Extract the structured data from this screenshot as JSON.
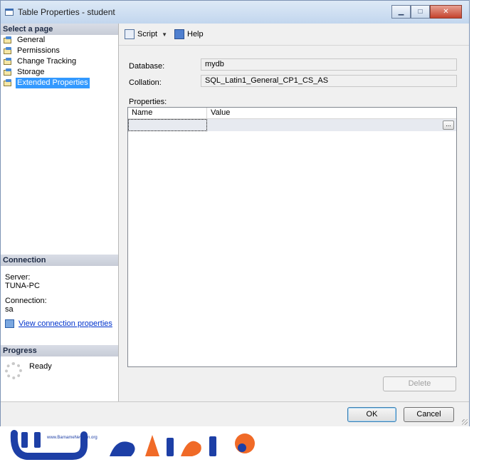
{
  "window": {
    "title": "Table Properties - student"
  },
  "left_pane": {
    "select_page_header": "Select a page",
    "pages": [
      {
        "label": "General",
        "selected": false
      },
      {
        "label": "Permissions",
        "selected": false
      },
      {
        "label": "Change Tracking",
        "selected": false
      },
      {
        "label": "Storage",
        "selected": false
      },
      {
        "label": "Extended Properties",
        "selected": true
      }
    ],
    "connection_header": "Connection",
    "server_label": "Server:",
    "server_value": "TUNA-PC",
    "connection_label": "Connection:",
    "connection_value": "sa",
    "view_connection_link": "View connection properties",
    "progress_header": "Progress",
    "progress_status": "Ready"
  },
  "toolbar": {
    "script_label": "Script",
    "help_label": "Help"
  },
  "fields": {
    "database_label": "Database:",
    "database_value": "mydb",
    "collation_label": "Collation:",
    "collation_value": "SQL_Latin1_General_CP1_CS_AS",
    "properties_label": "Properties:"
  },
  "grid": {
    "columns": [
      "Name",
      "Value"
    ],
    "ellipsis": "..."
  },
  "buttons": {
    "delete": "Delete",
    "ok": "OK",
    "cancel": "Cancel"
  },
  "logo": {
    "url_text": "www.BarnameNevisan.org"
  },
  "colors": {
    "selection": "#3399ff",
    "link": "#0033cc",
    "logo_blue": "#1d3fa6",
    "logo_orange": "#f06a27"
  }
}
